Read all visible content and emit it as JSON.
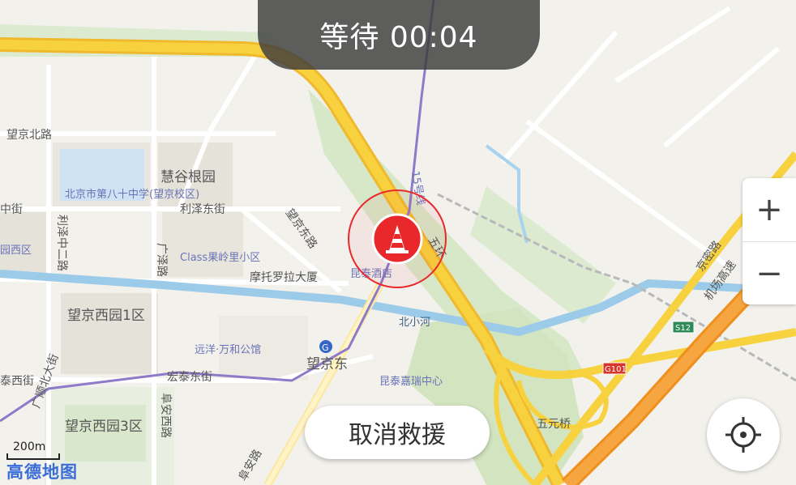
{
  "timer": {
    "text": "等待 00:04"
  },
  "zoom": {
    "in_label": "+",
    "out_label": "−"
  },
  "cancel_button": {
    "label": "取消救援"
  },
  "scale": {
    "text": "200m"
  },
  "logo": {
    "text": "高德地图"
  },
  "map": {
    "roads": {
      "wangjing_north": "望京北路",
      "lize_east": "利泽东街",
      "lize_middle": "利泽中二路",
      "guangze": "广泽路",
      "wangjing_east": "望京东路",
      "hongtai_east": "宏泰东街",
      "taixi": "泰西街",
      "fuan_west": "阜安西路",
      "fuan": "阜安路",
      "jingmi": "京密路",
      "airport_expressway": "机场高速",
      "zhong": "中街",
      "guangshun": "广顺北大街",
      "ring5": "五环",
      "metro15": "15号线"
    },
    "places": {
      "school": "北京市第八十中学(望京校区)",
      "huigu": "慧谷根园",
      "class_li": "Class果岭里小区",
      "motorola": "摩托罗拉大厦",
      "kuntai_hotel": "昆泰酒店",
      "wangjing_xiyuan1": "望京西园1区",
      "wangjing_xiyuan3": "望京西园3区",
      "xiyuan": "园西区",
      "yuanyang": "远洋·万和公馆",
      "wangjing_east_station": "望京东",
      "kuntai_center": "昆泰嘉瑞中心",
      "wuyuan_bridge": "五元桥",
      "beixiao_river": "北小河"
    },
    "shields": {
      "s12": "S12",
      "g101": "G101"
    }
  },
  "colors": {
    "accent_red": "#e8282b",
    "highway_yellow": "#f7d23e",
    "expressway_orange": "#f29a2e"
  }
}
